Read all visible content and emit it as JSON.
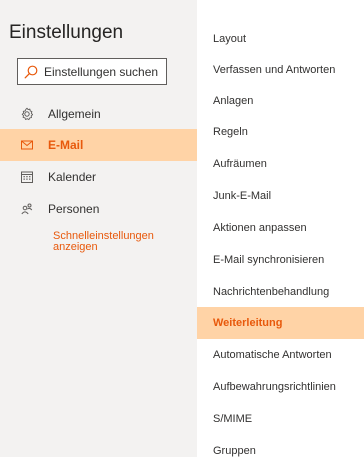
{
  "settings": {
    "title": "Einstellungen",
    "search": {
      "placeholder": "Einstellungen suchen",
      "value": ""
    },
    "categories": [
      {
        "label": "Allgemein",
        "icon": "gear-icon",
        "active": false
      },
      {
        "label": "E-Mail",
        "icon": "mail-icon",
        "active": true
      },
      {
        "label": "Kalender",
        "icon": "calendar-icon",
        "active": false
      },
      {
        "label": "Personen",
        "icon": "people-icon",
        "active": false
      }
    ],
    "quick_settings_link": "Schnelleinstellungen anzeigen"
  },
  "mail_settings": {
    "items": [
      {
        "label": "Layout",
        "active": false
      },
      {
        "label": "Verfassen und Antworten",
        "active": false
      },
      {
        "label": "Anlagen",
        "active": false
      },
      {
        "label": "Regeln",
        "active": false
      },
      {
        "label": "Aufräumen",
        "active": false
      },
      {
        "label": "Junk-E-Mail",
        "active": false
      },
      {
        "label": "Aktionen anpassen",
        "active": false
      },
      {
        "label": "E-Mail synchronisieren",
        "active": false
      },
      {
        "label": "Nachrichtenbehandlung",
        "active": false
      },
      {
        "label": "Weiterleitung",
        "active": true
      },
      {
        "label": "Automatische Antworten",
        "active": false
      },
      {
        "label": "Aufbewahrungsrichtlinien",
        "active": false
      },
      {
        "label": "S/MIME",
        "active": false
      },
      {
        "label": "Gruppen",
        "active": false
      }
    ]
  },
  "colors": {
    "accent": "#e8590c",
    "selected_background": "#ffd3a6",
    "pane_background": "#f3f2f1"
  }
}
